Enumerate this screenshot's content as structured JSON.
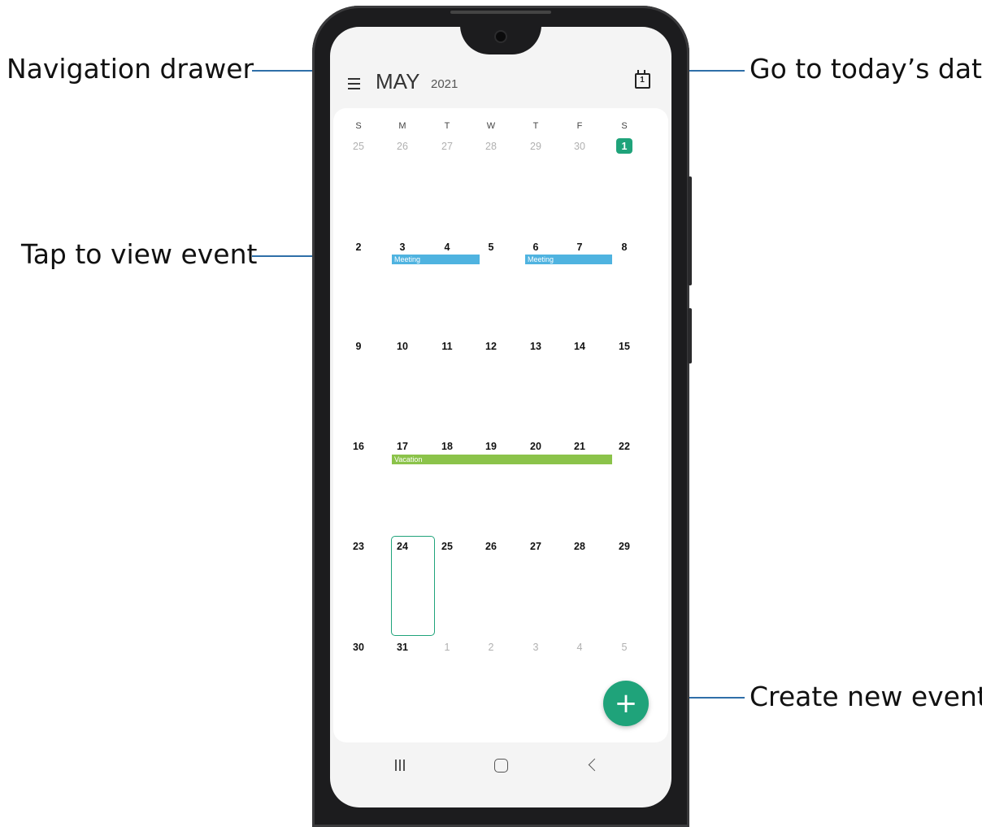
{
  "callouts": {
    "navigation_drawer": "Navigation drawer",
    "go_to_today": "Go to today’s date",
    "tap_to_view": "Tap to view event",
    "create_new_event": "Create new event"
  },
  "header": {
    "month": "MAY",
    "year": "2021",
    "today_icon_number": "1"
  },
  "weekdays": [
    "S",
    "M",
    "T",
    "W",
    "T",
    "F",
    "S"
  ],
  "weeks": [
    [
      "25",
      "26",
      "27",
      "28",
      "29",
      "30",
      "1"
    ],
    [
      "2",
      "3",
      "4",
      "5",
      "6",
      "7",
      "8"
    ],
    [
      "9",
      "10",
      "11",
      "12",
      "13",
      "14",
      "15"
    ],
    [
      "16",
      "17",
      "18",
      "19",
      "20",
      "21",
      "22"
    ],
    [
      "23",
      "24",
      "25",
      "26",
      "27",
      "28",
      "29"
    ],
    [
      "30",
      "31",
      "1",
      "2",
      "3",
      "4",
      "5"
    ]
  ],
  "events": {
    "meeting_1": "Meeting",
    "meeting_2": "Meeting",
    "vacation": "Vacation"
  },
  "fab_label": "+",
  "colors": {
    "accent": "#1fa37a",
    "meeting": "#4fb3e0",
    "vacation": "#8bc34a",
    "callout_line": "#2f6fa8"
  },
  "icons": {
    "menu": "menu-icon",
    "today": "calendar-today-icon",
    "recent": "recent-apps-icon",
    "home": "home-icon",
    "back": "back-icon"
  }
}
